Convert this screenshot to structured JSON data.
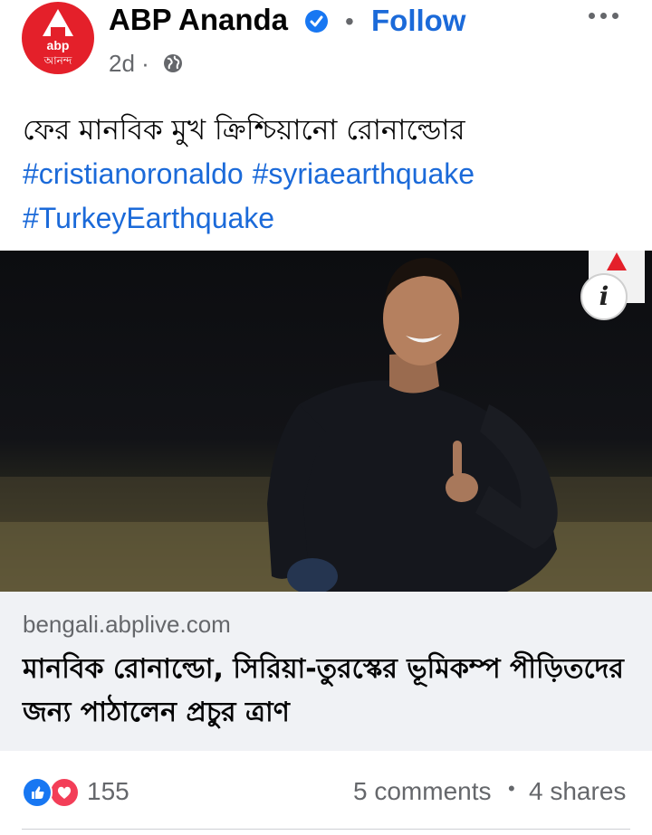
{
  "header": {
    "page_name": "ABP Ananda",
    "follow_label": "Follow",
    "separator": "•",
    "time": "2d ·",
    "avatar": {
      "logo_en": "abp",
      "logo_bn": "আনন্দ"
    }
  },
  "post": {
    "text": "ফের মানবিক মুখ ক্রিশ্চিয়ানো রোনাল্ডোর",
    "hashtags": [
      "#cristianoronaldo",
      "#syriaearthquake",
      "#TurkeyEarthquake"
    ]
  },
  "link_preview": {
    "domain": "bengali.abplive.com",
    "title": "মানবিক রোনাল্ডো, সিরিয়া-তুরস্কের ভূমিকম্প পীড়িতদের জন্য পাঠালেন প্রচুর ত্রাণ",
    "info_icon": "i"
  },
  "stats": {
    "reaction_count": "155",
    "comments": "5 comments",
    "bullet": "•",
    "shares": "4 shares"
  },
  "colors": {
    "brand_red": "#e4202a",
    "link_blue": "#1b6ad9",
    "like_blue": "#1877f2",
    "love_red": "#f33e58",
    "muted": "#65676b"
  },
  "icons": [
    "verified-icon",
    "more-icon",
    "globe-icon",
    "info-icon",
    "like-icon",
    "love-icon"
  ]
}
